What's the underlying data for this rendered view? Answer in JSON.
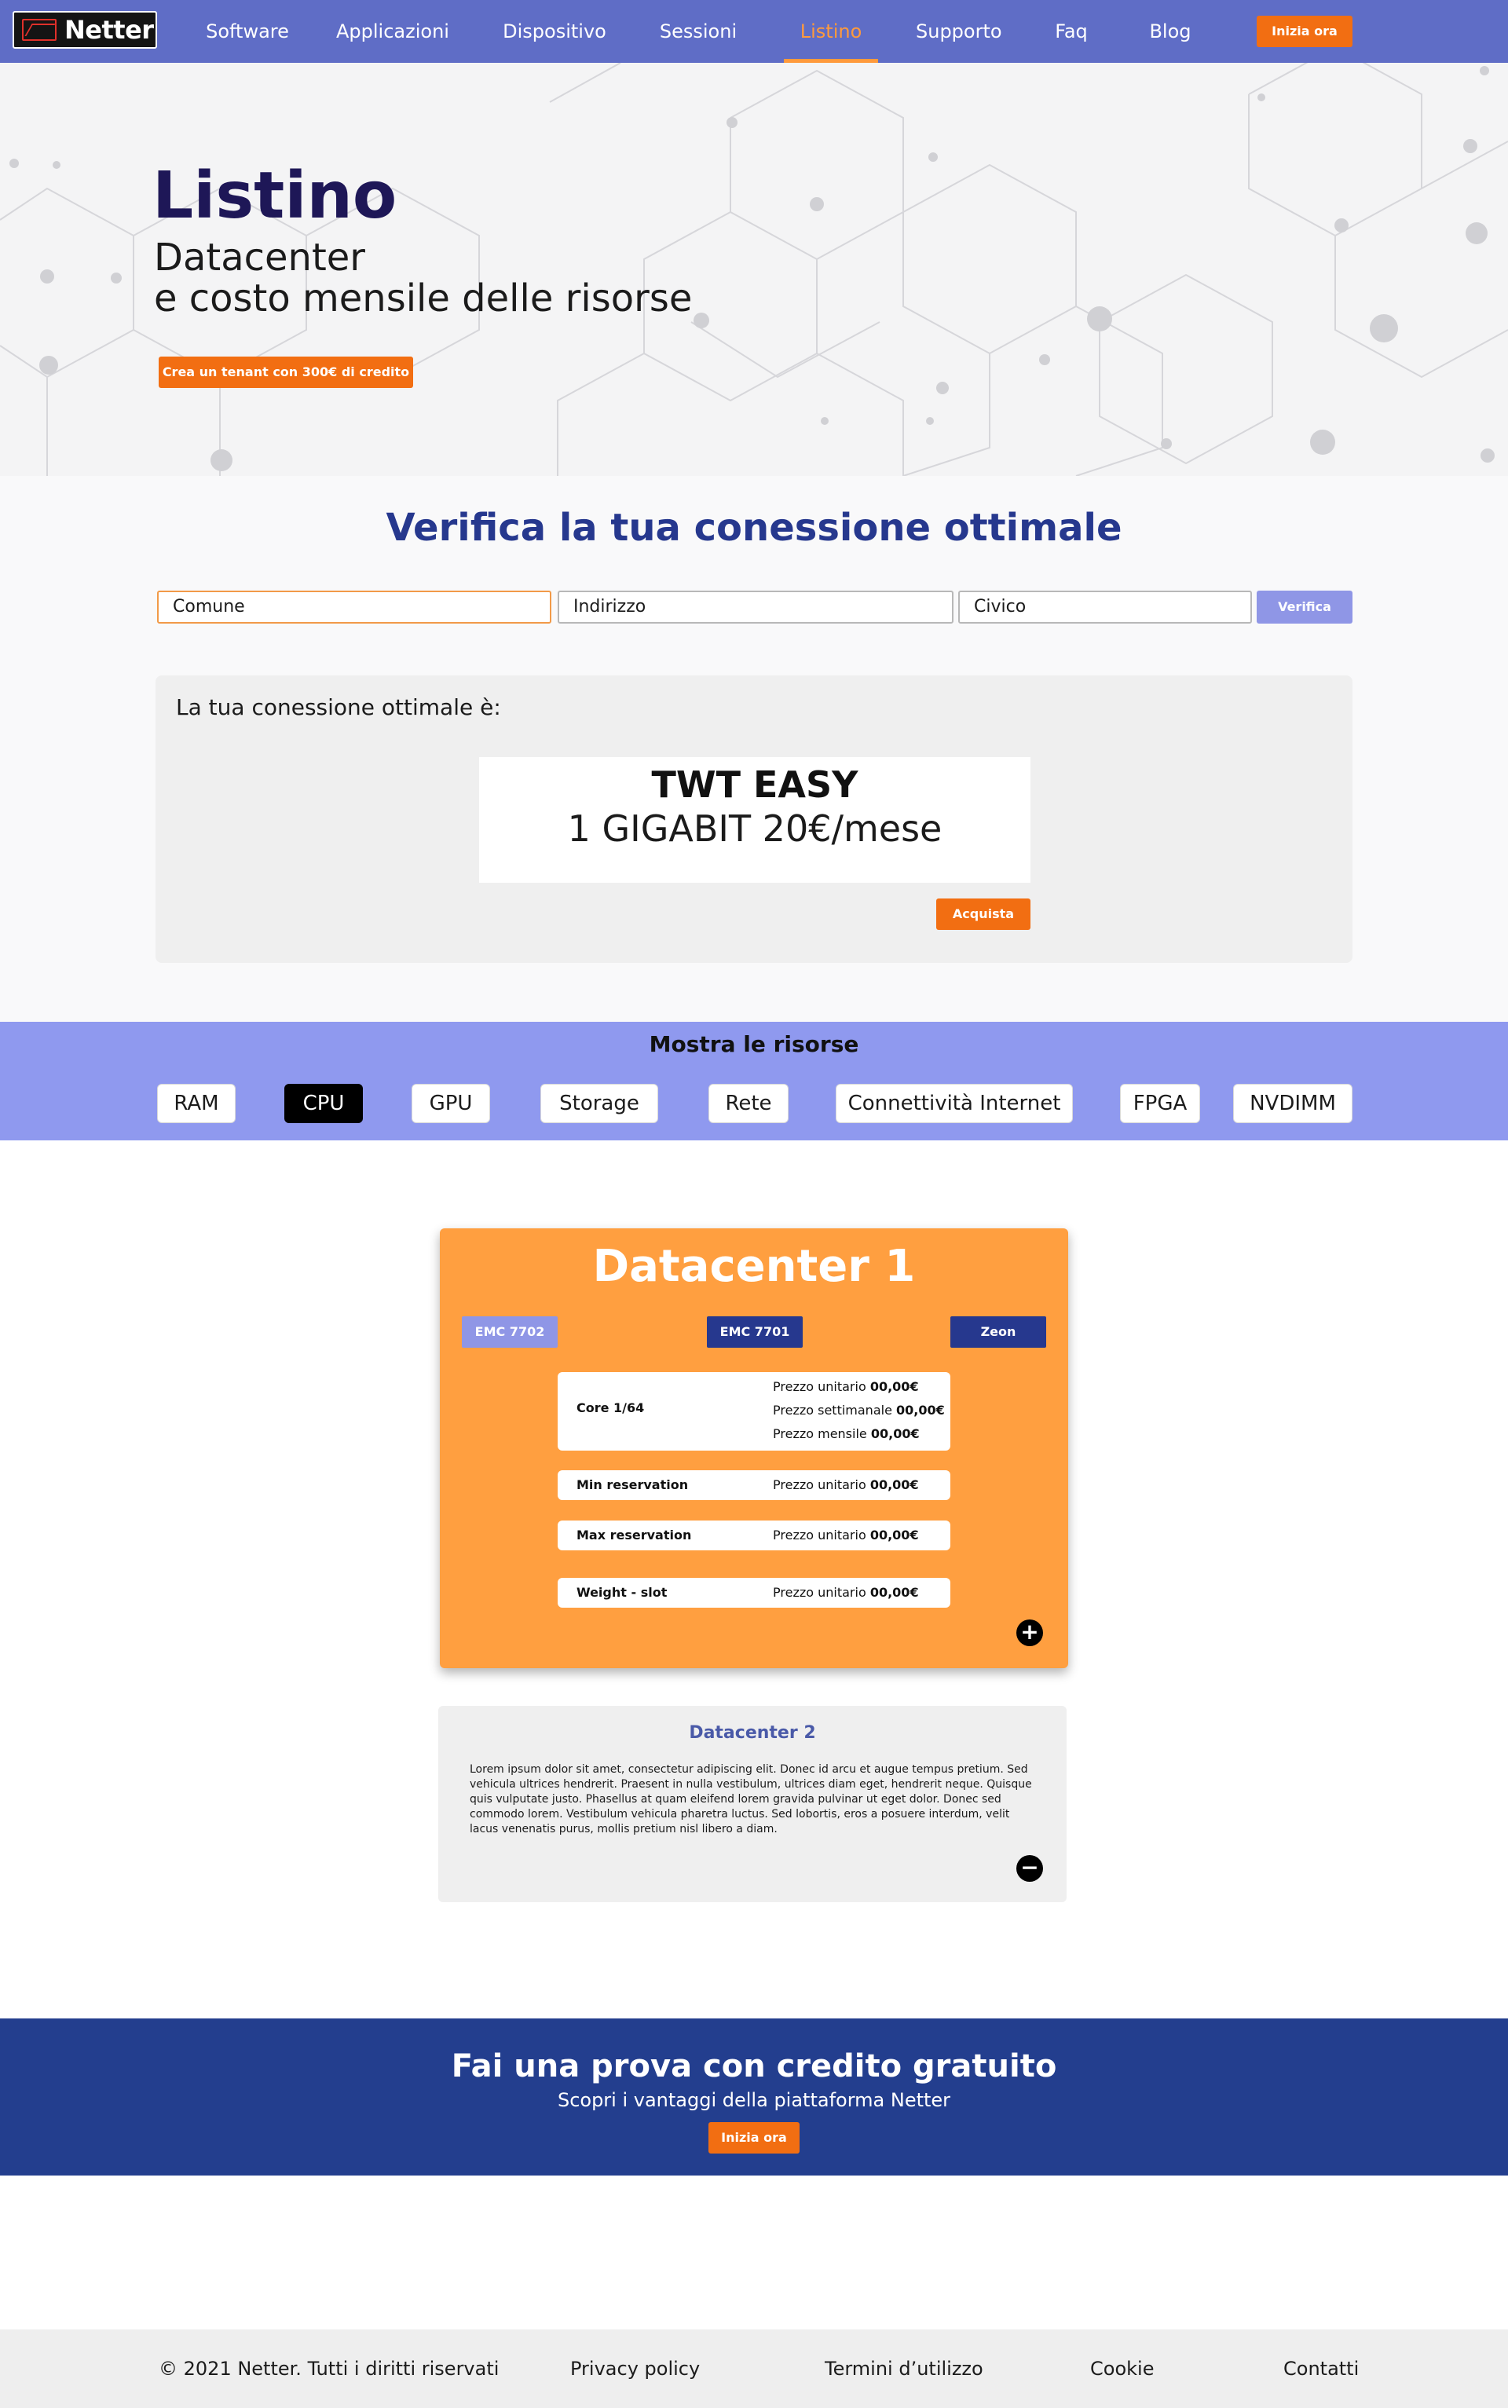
{
  "nav": {
    "logo_text": "Netter",
    "items": [
      "Software",
      "Applicazioni",
      "Dispositivo",
      "Sessioni",
      "Listino",
      "Supporto",
      "Faq",
      "Blog"
    ],
    "active": "Listino",
    "cta_label": "Inizia ora"
  },
  "hero": {
    "title": "Listino",
    "subtitle_line1": "Datacenter",
    "subtitle_line2": "e costo mensile delle risorse",
    "button_label": "Crea un tenant con 300€ di credito"
  },
  "verify": {
    "title": "Verifica la tua conessione ottimale",
    "comune_placeholder": "Comune",
    "indirizzo_placeholder": "Indirizzo",
    "civico_placeholder": "Civico",
    "button_label": "Verifica",
    "result_label": "La tua conessione ottimale è:",
    "plan_name": "TWT EASY",
    "plan_price": "1 GIGABIT 20€/mese",
    "buy_label": "Acquista"
  },
  "resources": {
    "title": "Mostra le risorse",
    "chips": [
      "RAM",
      "CPU",
      "GPU",
      "Storage",
      "Rete",
      "Connettività Internet",
      "FPGA",
      "NVDIMM"
    ],
    "active": "CPU"
  },
  "datacenter1": {
    "title": "Datacenter 1",
    "tabs": [
      "EMC 7702",
      "EMC 7701",
      "Zeon"
    ],
    "rows": [
      {
        "label": "Core 1/64",
        "prices": [
          {
            "name": "Prezzo unitario",
            "value": "00,00€"
          },
          {
            "name": "Prezzo settimanale",
            "value": "00,00€"
          },
          {
            "name": "Prezzo mensile",
            "value": "00,00€"
          }
        ]
      },
      {
        "label": "Min reservation",
        "prices": [
          {
            "name": "Prezzo unitario",
            "value": "00,00€"
          }
        ]
      },
      {
        "label": "Max reservation",
        "prices": [
          {
            "name": "Prezzo unitario",
            "value": "00,00€"
          }
        ]
      },
      {
        "label": "Weight - slot",
        "prices": [
          {
            "name": "Prezzo unitario",
            "value": "00,00€"
          }
        ]
      }
    ],
    "toggle": "+"
  },
  "datacenter2": {
    "title": "Datacenter 2",
    "text": "Lorem ipsum dolor sit amet, consectetur adipiscing elit. Donec id arcu et augue tempus pretium. Sed vehicula ultrices hendrerit. Praesent in nulla vestibulum, ultrices diam eget, hendrerit neque. Quisque quis vulputate justo. Phasellus at quam eleifend lorem gravida pulvinar ut eget dolor. Donec sed commodo lorem. Vestibulum vehicula pharetra luctus. Sed lobortis, eros a posuere interdum, velit lacus venenatis purus, mollis pretium nisl libero a diam.",
    "toggle": "−"
  },
  "cta": {
    "title": "Fai una prova con credito gratuito",
    "subtitle": "Scopri i vantaggi della piattaforma Netter",
    "button_label": "Inizia ora"
  },
  "footer": {
    "copyright": "© 2021 Netter. Tutti i diritti riservati",
    "privacy": "Privacy policy",
    "terms": "Termini d’utilizzo",
    "cookie": "Cookie",
    "contacts": "Contatti"
  },
  "colors": {
    "nav": "#5f6dc6",
    "accent": "#f26e12",
    "active_nav": "#ff9a3c",
    "title_blue": "#26388e",
    "resources_bg": "#8f99ef",
    "dc1_bg": "#ff9f40",
    "cta_bg": "#233e8e"
  }
}
